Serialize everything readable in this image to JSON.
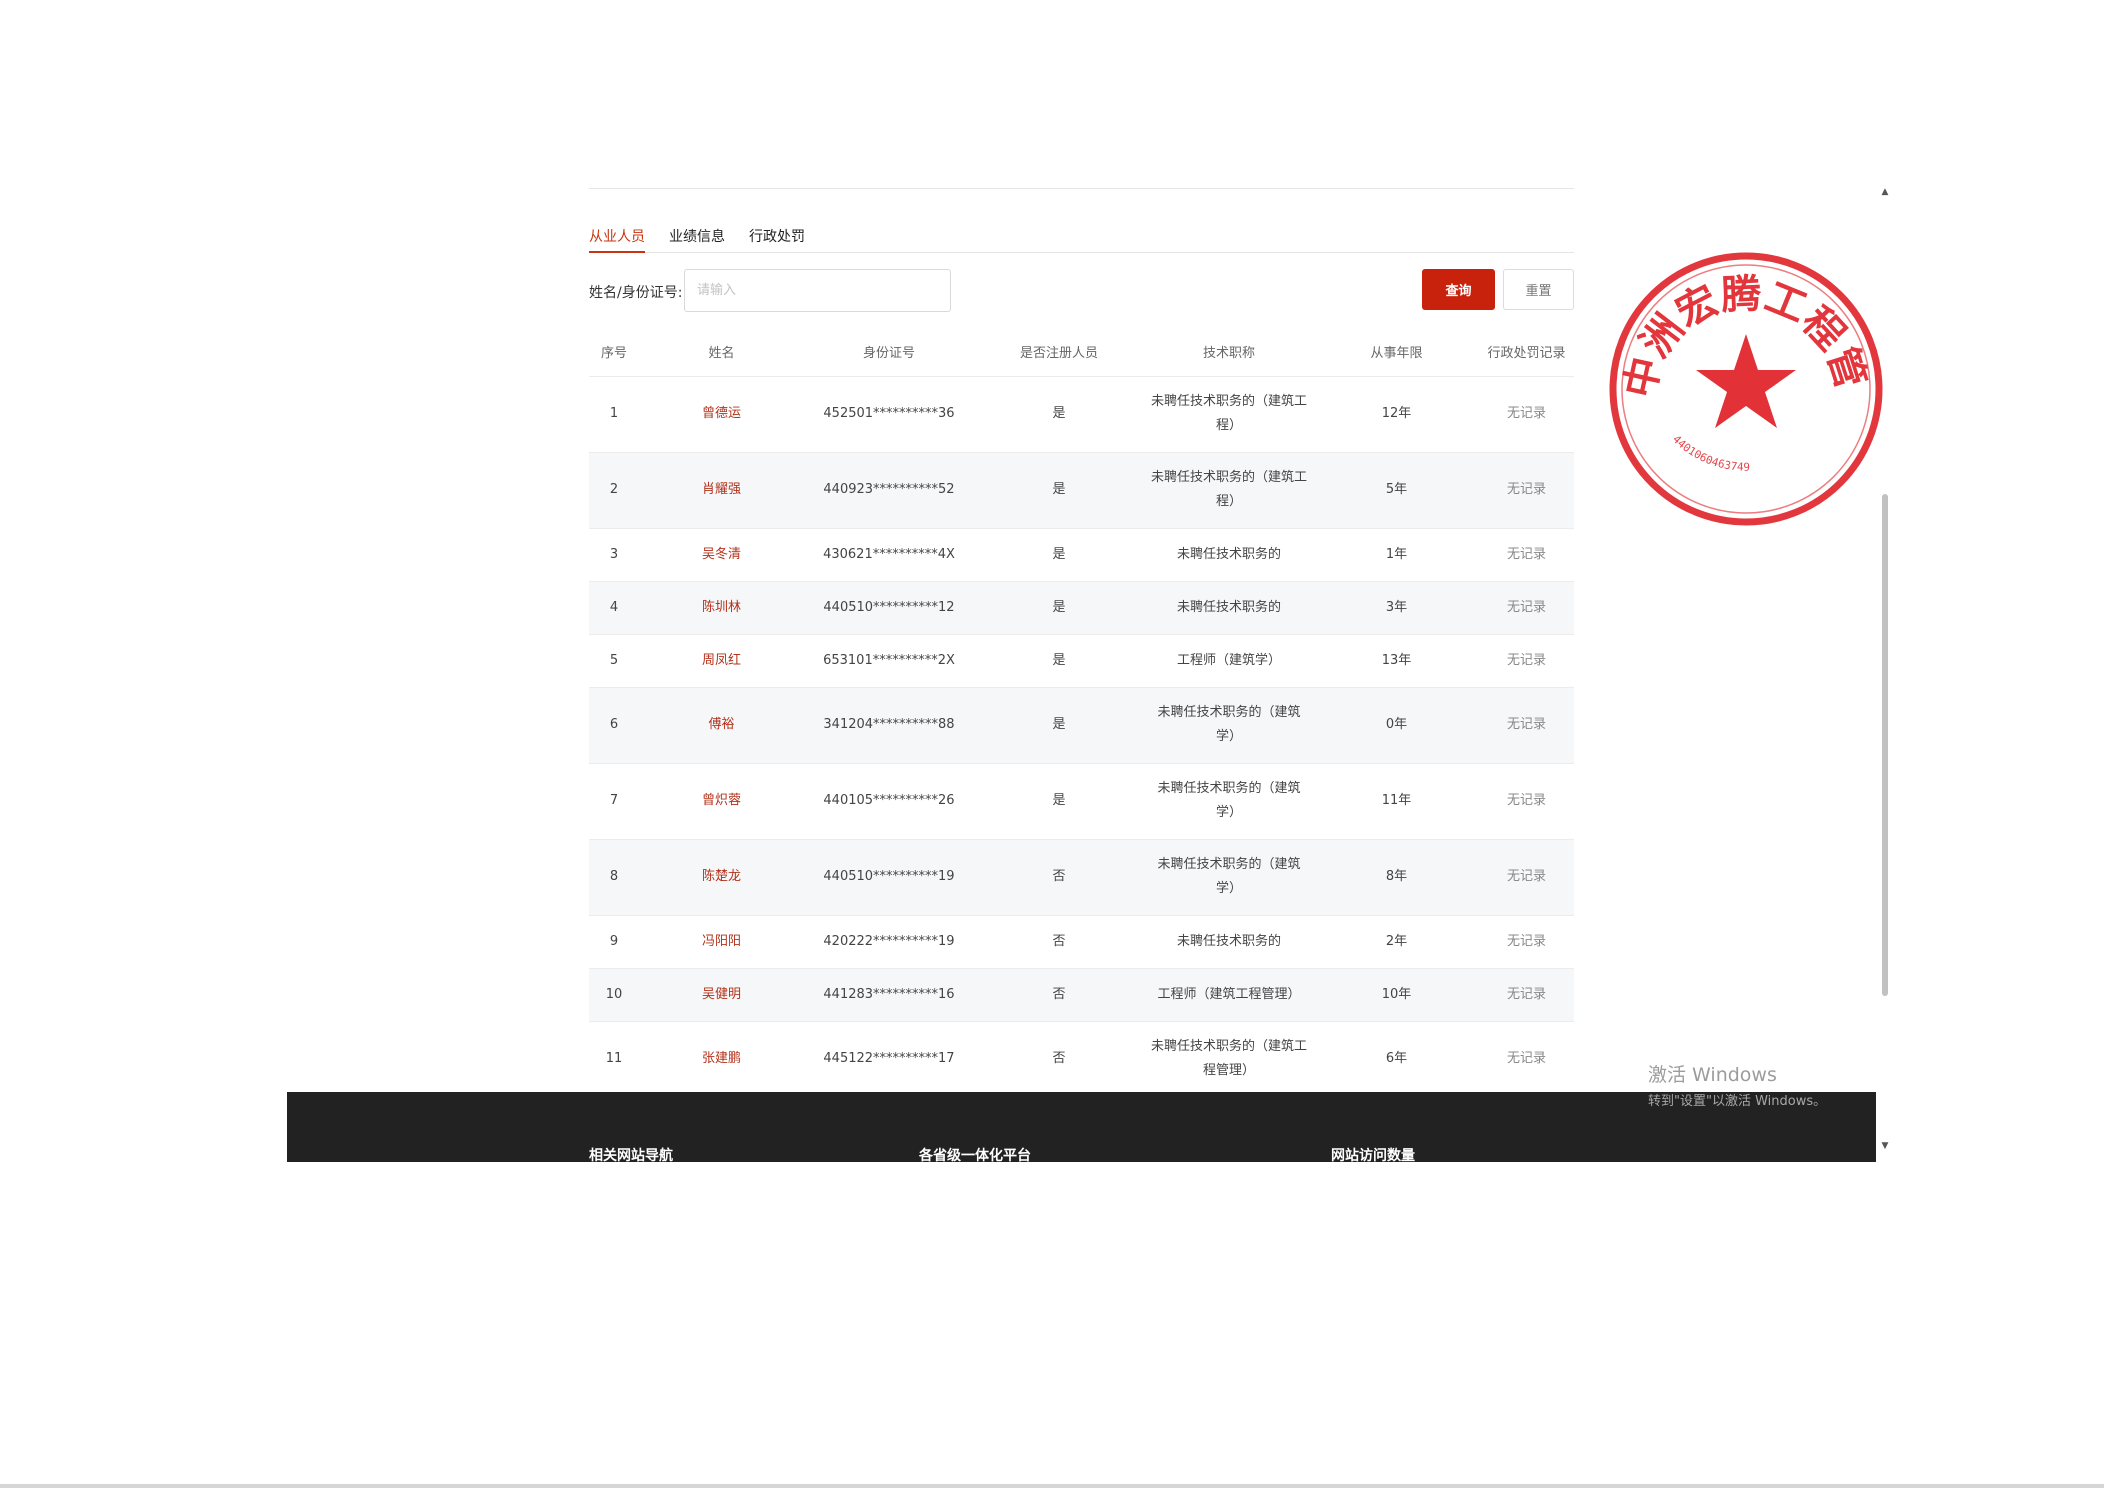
{
  "tabs": [
    "从业人员",
    "业绩信息",
    "行政处罚"
  ],
  "filter": {
    "label": "姓名/身份证号:",
    "placeholder": "请输入",
    "query_button": "查询",
    "reset_button": "重置"
  },
  "table": {
    "headers": [
      "序号",
      "姓名",
      "身份证号",
      "是否注册人员",
      "技术职称",
      "从事年限",
      "行政处罚记录"
    ],
    "rows": [
      {
        "no": "1",
        "name": "曾德运",
        "id": "452501**********36",
        "registered": "是",
        "title": "未聘任技术职务的（建筑工程）",
        "years": "12年",
        "penalty": "无记录"
      },
      {
        "no": "2",
        "name": "肖耀强",
        "id": "440923**********52",
        "registered": "是",
        "title": "未聘任技术职务的（建筑工程）",
        "years": "5年",
        "penalty": "无记录"
      },
      {
        "no": "3",
        "name": "吴冬清",
        "id": "430621**********4X",
        "registered": "是",
        "title": "未聘任技术职务的",
        "years": "1年",
        "penalty": "无记录"
      },
      {
        "no": "4",
        "name": "陈圳林",
        "id": "440510**********12",
        "registered": "是",
        "title": "未聘任技术职务的",
        "years": "3年",
        "penalty": "无记录"
      },
      {
        "no": "5",
        "name": "周凤红",
        "id": "653101**********2X",
        "registered": "是",
        "title": "工程师（建筑学）",
        "years": "13年",
        "penalty": "无记录"
      },
      {
        "no": "6",
        "name": "傅裕",
        "id": "341204**********88",
        "registered": "是",
        "title": "未聘任技术职务的（建筑学）",
        "years": "0年",
        "penalty": "无记录"
      },
      {
        "no": "7",
        "name": "曾炽蓉",
        "id": "440105**********26",
        "registered": "是",
        "title": "未聘任技术职务的（建筑学）",
        "years": "11年",
        "penalty": "无记录"
      },
      {
        "no": "8",
        "name": "陈楚龙",
        "id": "440510**********19",
        "registered": "否",
        "title": "未聘任技术职务的（建筑学）",
        "years": "8年",
        "penalty": "无记录"
      },
      {
        "no": "9",
        "name": "冯阳阳",
        "id": "420222**********19",
        "registered": "否",
        "title": "未聘任技术职务的",
        "years": "2年",
        "penalty": "无记录"
      },
      {
        "no": "10",
        "name": "吴健明",
        "id": "441283**********16",
        "registered": "否",
        "title": "工程师（建筑工程管理）",
        "years": "10年",
        "penalty": "无记录"
      },
      {
        "no": "11",
        "name": "张建鹏",
        "id": "445122**********17",
        "registered": "否",
        "title": "未聘任技术职务的（建筑工程管理）",
        "years": "6年",
        "penalty": "无记录"
      }
    ]
  },
  "footer": {
    "col1": "相关网站导航",
    "col2": "各省级一体化平台",
    "col3": "网站访问数量"
  },
  "stamp": {
    "text": "中洲宏腾工程管理有限公司",
    "number": "4401060463749",
    "color": "#e0262c"
  },
  "watermark": {
    "title": "激活 Windows",
    "subtitle": "转到\"设置\"以激活 Windows。"
  },
  "colors": {
    "accent": "#c8220d",
    "name_link": "#b3321b",
    "footer_bg": "#222222"
  }
}
